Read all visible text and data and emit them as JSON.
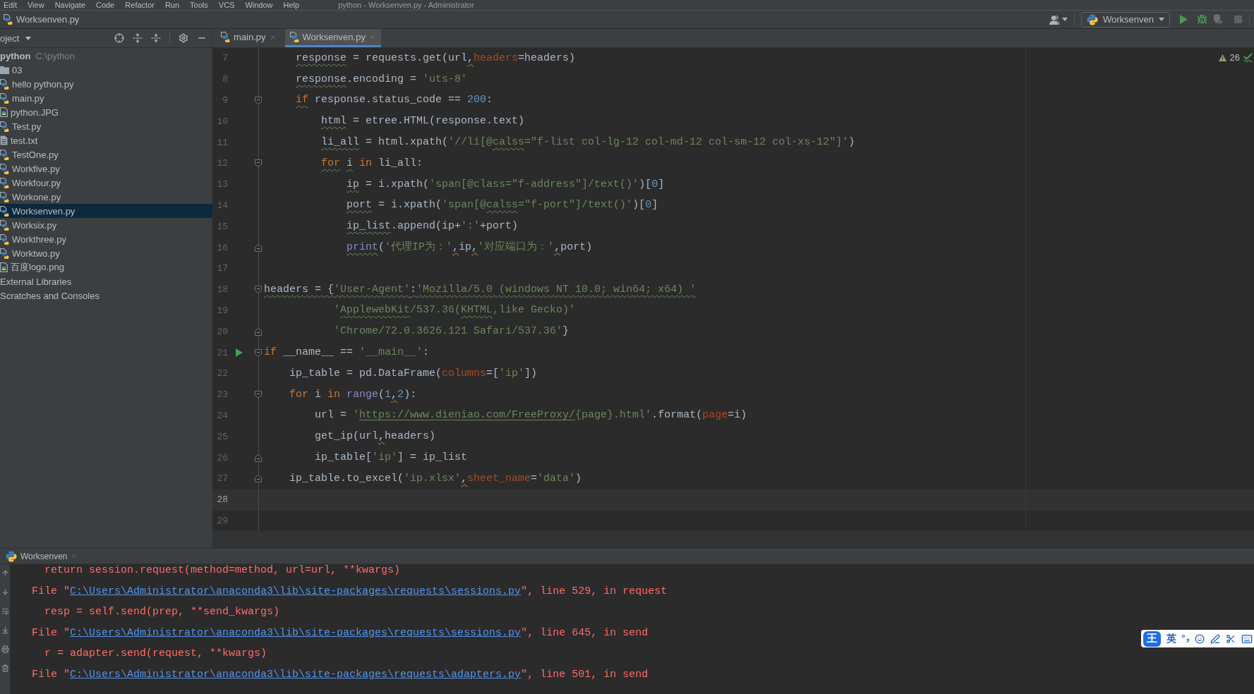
{
  "menu_bar": {
    "items": [
      "Edit",
      "View",
      "Navigate",
      "Code",
      "Refactor",
      "Run",
      "Tools",
      "VCS",
      "Window",
      "Help"
    ],
    "title": "python - Worksenven.py - Administrator"
  },
  "navigation_bar": {
    "breadcrumb": "Worksenven.py",
    "run_configuration": "Worksenven"
  },
  "project_panel": {
    "view": "oject",
    "tree": [
      {
        "label": "python",
        "path": "C:\\python",
        "selected": false,
        "children": [
          {
            "kind": "folder",
            "label": "03",
            "selected": false
          },
          {
            "kind": "script",
            "label": "hello python.py",
            "selected": false
          },
          {
            "kind": "script",
            "label": "main.py",
            "selected": false
          },
          {
            "kind": "image",
            "label": "python.JPG",
            "selected": false
          },
          {
            "kind": "script",
            "label": "Test.py",
            "selected": false
          },
          {
            "kind": "text",
            "label": "test.txt",
            "selected": false
          },
          {
            "kind": "script",
            "label": "TestOne.py",
            "selected": false
          },
          {
            "kind": "script",
            "label": "Workfive.py",
            "selected": false
          },
          {
            "kind": "script",
            "label": "Workfour.py",
            "selected": false
          },
          {
            "kind": "script",
            "label": "Workone.py",
            "selected": false
          },
          {
            "kind": "script",
            "label": "Worksenven.py",
            "selected": true
          },
          {
            "kind": "script",
            "label": "Worksix.py",
            "selected": false
          },
          {
            "kind": "script",
            "label": "Workthree.py",
            "selected": false
          },
          {
            "kind": "script",
            "label": "Worktwo.py",
            "selected": false
          },
          {
            "kind": "image",
            "label": "百度logo.png",
            "selected": false
          }
        ]
      },
      {
        "label": "External Libraries",
        "selected": false
      },
      {
        "label": "Scratches and Consoles",
        "selected": false
      }
    ]
  },
  "editor": {
    "tabs": [
      {
        "label": "main.py",
        "selected": false
      },
      {
        "label": "Worksenven.py",
        "selected": true
      }
    ],
    "warning_count": "26",
    "lines": [
      {
        "number": "7",
        "kind": "code",
        "current": false,
        "run": false,
        "tokens": [
          {
            "kind": "weak_plain",
            "text": "     response"
          },
          {
            "kind": "plain",
            "text": " = requests.get(url"
          },
          {
            "kind": "pep_comma",
            "text": ","
          },
          {
            "kind": "param",
            "text": "headers"
          },
          {
            "kind": "plain",
            "text": "=headers)"
          }
        ]
      },
      {
        "number": "8",
        "kind": "code",
        "current": false,
        "run": false,
        "tokens": [
          {
            "kind": "weak_plain",
            "text": "     response"
          },
          {
            "kind": "plain",
            "text": ".encoding = "
          },
          {
            "kind": "string",
            "text": "'uts-8'"
          }
        ]
      },
      {
        "number": "9",
        "kind": "fold_start",
        "current": false,
        "run": false,
        "tokens": [
          {
            "kind": "weak_keyword",
            "text": "     if"
          },
          {
            "kind": "plain",
            "text": " response.status_code == "
          },
          {
            "kind": "number",
            "text": "200"
          },
          {
            "kind": "plain",
            "text": ":"
          }
        ]
      },
      {
        "number": "10",
        "kind": "code",
        "current": false,
        "run": false,
        "tokens": [
          {
            "kind": "weak_plain",
            "text": "         html"
          },
          {
            "kind": "plain",
            "text": " = etree.HTML(response.text)"
          }
        ]
      },
      {
        "number": "11",
        "kind": "code",
        "current": false,
        "run": false,
        "tokens": [
          {
            "kind": "weak_plain",
            "text": "         li_all"
          },
          {
            "kind": "plain",
            "text": " = html.xpath("
          },
          {
            "kind": "string",
            "text": "'//li[@"
          },
          {
            "kind": "weak_string",
            "text": "calss"
          },
          {
            "kind": "string",
            "text": "=\"f-list col-lg-12 col-md-12 col-sm-12 col-xs-12\"]'"
          },
          {
            "kind": "plain",
            "text": ")"
          }
        ]
      },
      {
        "number": "12",
        "kind": "fold_start",
        "current": false,
        "run": false,
        "tokens": [
          {
            "kind": "weak_keyword",
            "text": "         for"
          },
          {
            "kind": "weak_plain",
            "text": " i"
          },
          {
            "kind": "keyword",
            "text": " in"
          },
          {
            "kind": "plain",
            "text": " li_all:"
          }
        ]
      },
      {
        "number": "13",
        "kind": "code",
        "current": false,
        "run": false,
        "tokens": [
          {
            "kind": "weak_plain",
            "text": "             ip"
          },
          {
            "kind": "plain",
            "text": " = i.xpath("
          },
          {
            "kind": "string",
            "text": "'span[@class=\"f-address\"]/text()'"
          },
          {
            "kind": "plain",
            "text": ")["
          },
          {
            "kind": "number",
            "text": "0"
          },
          {
            "kind": "plain",
            "text": "]"
          }
        ]
      },
      {
        "number": "14",
        "kind": "code",
        "current": false,
        "run": false,
        "tokens": [
          {
            "kind": "weak_plain",
            "text": "             port"
          },
          {
            "kind": "plain",
            "text": " = i.xpath("
          },
          {
            "kind": "string",
            "text": "'span[@"
          },
          {
            "kind": "weak_string",
            "text": "calss"
          },
          {
            "kind": "string",
            "text": "=\"f-port\"]/text()'"
          },
          {
            "kind": "plain",
            "text": ")["
          },
          {
            "kind": "number",
            "text": "0"
          },
          {
            "kind": "plain",
            "text": "]"
          }
        ]
      },
      {
        "number": "15",
        "kind": "code",
        "current": false,
        "run": false,
        "tokens": [
          {
            "kind": "weak_plain",
            "text": "             ip_list"
          },
          {
            "kind": "plain",
            "text": ".append(ip+"
          },
          {
            "kind": "string",
            "text": "':'"
          },
          {
            "kind": "plain",
            "text": "+port)"
          }
        ]
      },
      {
        "number": "16",
        "kind": "fold_end",
        "current": false,
        "run": false,
        "tokens": [
          {
            "kind": "weak_builtin",
            "text": "             print"
          },
          {
            "kind": "plain",
            "text": "("
          },
          {
            "kind": "string",
            "text": "'代理IP为：'"
          },
          {
            "kind": "pep_comma",
            "text": ","
          },
          {
            "kind": "plain",
            "text": "ip"
          },
          {
            "kind": "pep_comma",
            "text": ","
          },
          {
            "kind": "string",
            "text": "'对应端口为：'"
          },
          {
            "kind": "pep_comma",
            "text": ","
          },
          {
            "kind": "plain",
            "text": "port)"
          }
        ]
      },
      {
        "number": "17",
        "kind": "code",
        "current": false,
        "run": false
      },
      {
        "number": "18",
        "kind": "fold_start",
        "current": false,
        "run": false,
        "tokens": [
          {
            "kind": "weak_plain",
            "text": "headers = {"
          },
          {
            "kind": "weak_string",
            "text": "'User-Agent'"
          },
          {
            "kind": "weak_plain",
            "text": ":"
          },
          {
            "kind": "weak_string",
            "text": "'Mozilla/5.0 (windows NT 10.0; win64; x64) '"
          }
        ]
      },
      {
        "number": "19",
        "kind": "code",
        "current": false,
        "run": false,
        "tokens": [
          {
            "kind": "string",
            "text": "           '"
          },
          {
            "kind": "weak_string",
            "text": "ApplewebKit"
          },
          {
            "kind": "string",
            "text": "/537.36("
          },
          {
            "kind": "weak_string",
            "text": "KHTML"
          },
          {
            "kind": "string",
            "text": ",like Gecko)'"
          }
        ]
      },
      {
        "number": "20",
        "kind": "fold_end",
        "current": false,
        "run": false,
        "tokens": [
          {
            "kind": "string",
            "text": "           'Chrome/72.0.3626.121 Safari/537.36'"
          },
          {
            "kind": "plain",
            "text": "}"
          }
        ]
      },
      {
        "number": "21",
        "kind": "fold_start",
        "current": false,
        "run": true,
        "tokens": [
          {
            "kind": "keyword",
            "text": "if"
          },
          {
            "kind": "plain",
            "text": " __name__ == "
          },
          {
            "kind": "string",
            "text": "'__main__'"
          },
          {
            "kind": "plain",
            "text": ":"
          }
        ]
      },
      {
        "number": "22",
        "kind": "code",
        "current": false,
        "run": false,
        "tokens": [
          {
            "kind": "plain",
            "text": "    ip_table = pd.DataFrame("
          },
          {
            "kind": "param",
            "text": "columns"
          },
          {
            "kind": "plain",
            "text": "=["
          },
          {
            "kind": "string",
            "text": "'ip'"
          },
          {
            "kind": "plain",
            "text": "])"
          }
        ]
      },
      {
        "number": "23",
        "kind": "fold_start",
        "current": false,
        "run": false,
        "tokens": [
          {
            "kind": "keyword",
            "text": "    for"
          },
          {
            "kind": "plain",
            "text": " i "
          },
          {
            "kind": "keyword",
            "text": "in"
          },
          {
            "kind": "builtin",
            "text": " range"
          },
          {
            "kind": "plain",
            "text": "("
          },
          {
            "kind": "number",
            "text": "1"
          },
          {
            "kind": "pep_comma",
            "text": ","
          },
          {
            "kind": "number",
            "text": "2"
          },
          {
            "kind": "plain",
            "text": "):"
          }
        ]
      },
      {
        "number": "24",
        "kind": "code",
        "current": false,
        "run": false,
        "tokens": [
          {
            "kind": "plain",
            "text": "        url = "
          },
          {
            "kind": "string",
            "text": "'"
          },
          {
            "kind": "link",
            "text": "https://www.dieniao.com/FreeProxy/"
          },
          {
            "kind": "string",
            "text": "{page}.html'"
          },
          {
            "kind": "plain",
            "text": ".format("
          },
          {
            "kind": "param",
            "text": "page"
          },
          {
            "kind": "plain",
            "text": "=i)"
          }
        ]
      },
      {
        "number": "25",
        "kind": "code",
        "current": false,
        "run": false,
        "tokens": [
          {
            "kind": "plain",
            "text": "        get_ip(url"
          },
          {
            "kind": "pep_comma",
            "text": ","
          },
          {
            "kind": "plain",
            "text": "headers)"
          }
        ]
      },
      {
        "number": "26",
        "kind": "fold_end",
        "current": false,
        "run": false,
        "tokens": [
          {
            "kind": "plain",
            "text": "        ip_table["
          },
          {
            "kind": "string",
            "text": "'ip'"
          },
          {
            "kind": "plain",
            "text": "] = ip_list"
          }
        ]
      },
      {
        "number": "27",
        "kind": "fold_end",
        "current": false,
        "run": false,
        "tokens": [
          {
            "kind": "plain",
            "text": "    ip_table.to_excel("
          },
          {
            "kind": "string",
            "text": "'ip.xlsx'"
          },
          {
            "kind": "pep_comma",
            "text": ","
          },
          {
            "kind": "param",
            "text": "sheet_name"
          },
          {
            "kind": "plain",
            "text": "="
          },
          {
            "kind": "string",
            "text": "'data'"
          },
          {
            "kind": "plain",
            "text": ")"
          }
        ]
      },
      {
        "number": "28",
        "kind": "code",
        "current": true,
        "run": false
      },
      {
        "number": "29",
        "kind": "code",
        "current": false,
        "run": false
      }
    ]
  },
  "run_panel": {
    "tab": "Worksenven",
    "output": [
      [
        {
          "kind": "text",
          "text": "    return session.request(method=method, url=url, **kwargs)"
        }
      ],
      [
        {
          "kind": "text",
          "text": "  File \""
        },
        {
          "kind": "link",
          "text": "C:\\Users\\Administrator\\anaconda3\\lib\\site-packages\\requests\\sessions.py"
        },
        {
          "kind": "text",
          "text": "\", line 529, in request"
        }
      ],
      [
        {
          "kind": "text",
          "text": "    resp = self.send(prep, **send_kwargs)"
        }
      ],
      [
        {
          "kind": "text",
          "text": "  File \""
        },
        {
          "kind": "link",
          "text": "C:\\Users\\Administrator\\anaconda3\\lib\\site-packages\\requests\\sessions.py"
        },
        {
          "kind": "text",
          "text": "\", line 645, in send"
        }
      ],
      [
        {
          "kind": "text",
          "text": "    r = adapter.send(request, **kwargs)"
        }
      ],
      [
        {
          "kind": "text",
          "text": "  File \""
        },
        {
          "kind": "link",
          "text": "C:\\Users\\Administrator\\anaconda3\\lib\\site-packages\\requests\\adapters.py"
        },
        {
          "kind": "text",
          "text": "\", line 501, in send"
        }
      ]
    ]
  },
  "input_method_bar": {
    "logo": "王",
    "mode": "英"
  }
}
